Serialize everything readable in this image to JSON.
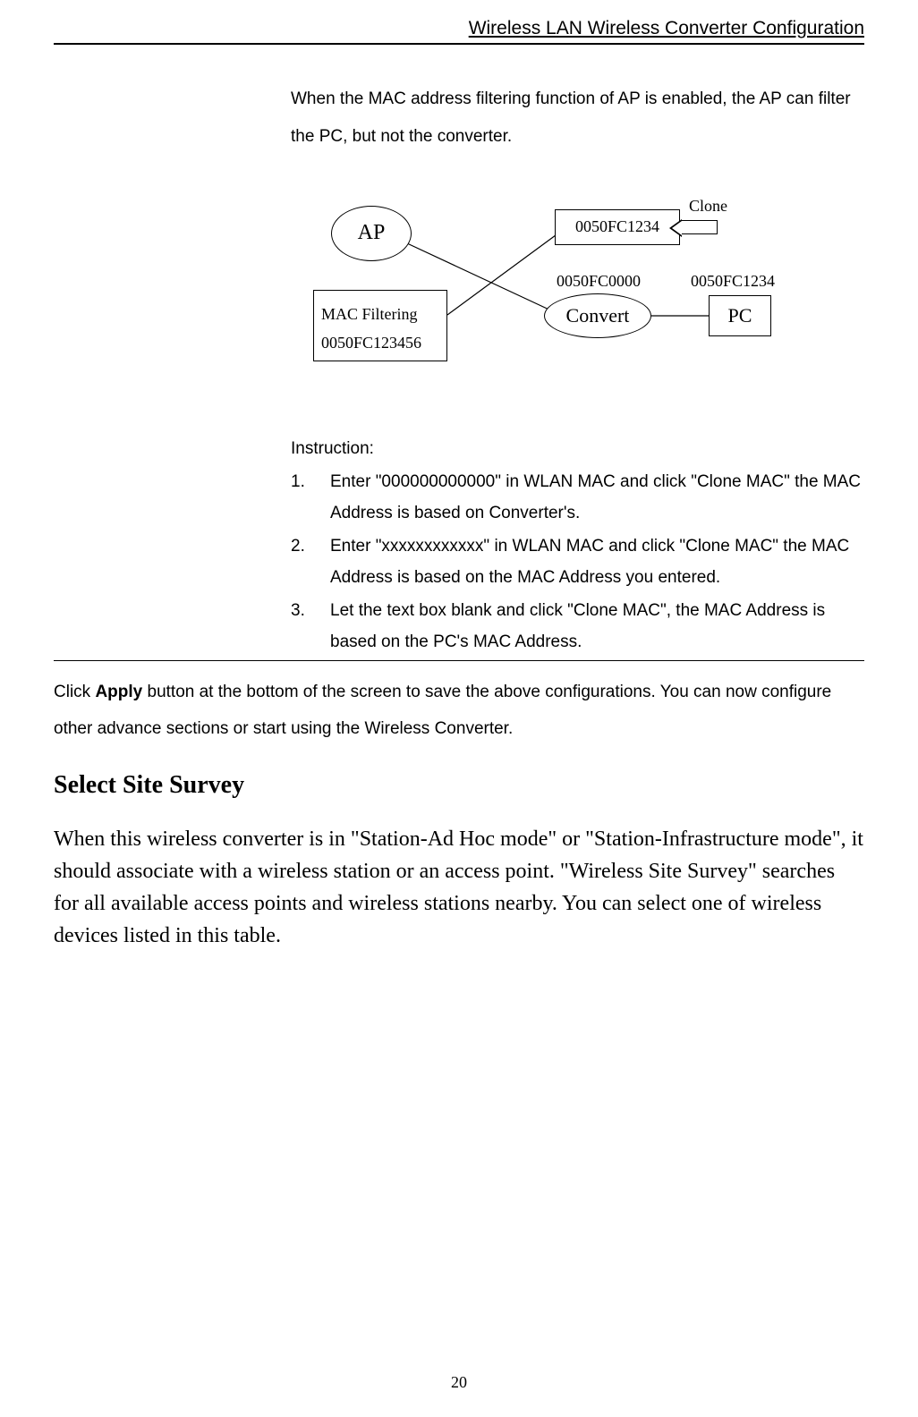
{
  "header": {
    "title": "Wireless LAN Wireless Converter Configuration"
  },
  "intro": "When the MAC address filtering function of AP is enabled, the AP can filter the PC, but not the converter.",
  "diagram": {
    "ap_label": "AP",
    "mac_box_line1": "MAC Filtering",
    "mac_box_line2": "0050FC123456",
    "clone_top_value": "0050FC1234",
    "clone_label": "Clone",
    "convert_top_label": "0050FC0000",
    "pc_top_label": "0050FC1234",
    "convert_label": "Convert",
    "pc_label": "PC"
  },
  "instruction": {
    "title": "Instruction:",
    "items": [
      "Enter \"000000000000\" in WLAN MAC and click \"Clone MAC\" the MAC Address is based on Converter's.",
      "Enter \"xxxxxxxxxxxx\" in WLAN MAC and click \"Clone MAC\" the MAC Address is based on the MAC Address you entered.",
      "Let the text box blank and click \"Clone MAC\", the MAC Address is based on the PC's MAC Address."
    ]
  },
  "apply": {
    "prefix": "Click ",
    "bold": "Apply",
    "suffix": " button at the bottom of the screen to save the above configurations. You can now configure other advance sections or start using the Wireless Converter."
  },
  "section_heading": "Select Site Survey",
  "survey_para": "When this wireless converter is in \"Station-Ad Hoc mode\" or \"Station-Infrastructure mode\", it should associate with a wireless station or an access point. \"Wireless Site Survey\" searches for all available access points and wireless stations nearby. You can select one of wireless devices listed in this table.",
  "page_number": "20"
}
